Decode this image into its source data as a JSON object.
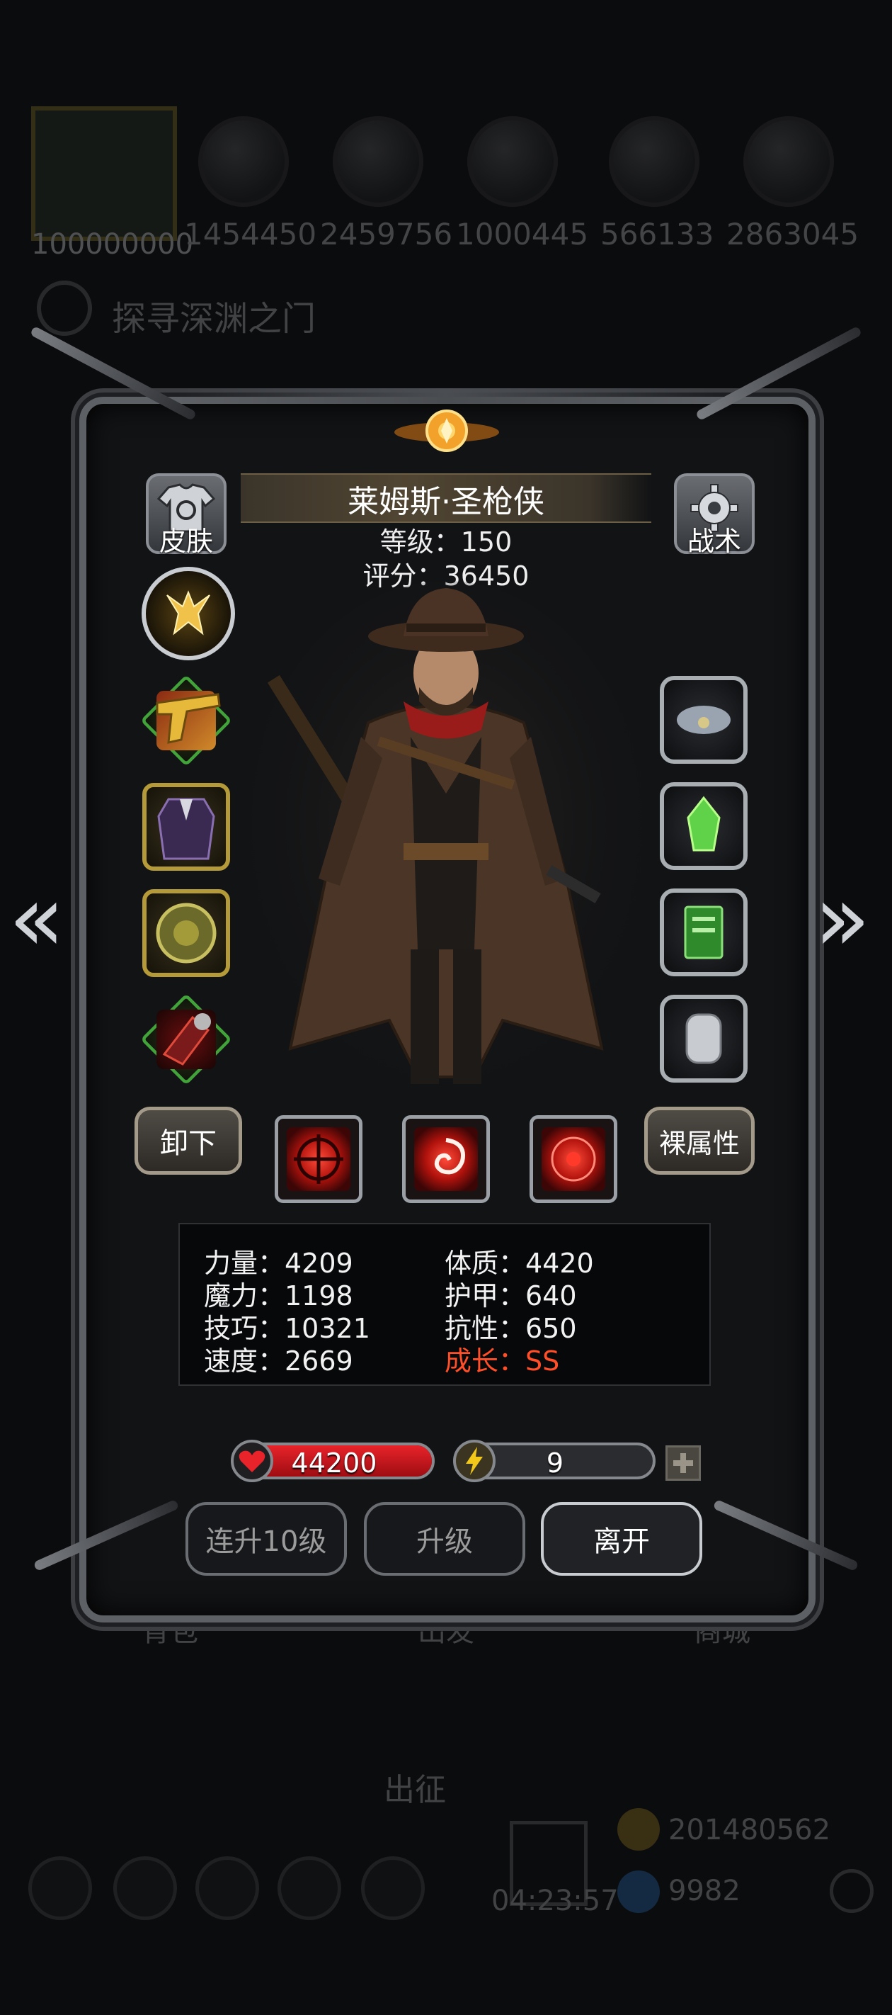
{
  "background": {
    "avatar_badge": "100000000",
    "resources": [
      "1454450",
      "2459756",
      "1000445",
      "566133",
      "2863045"
    ],
    "quest_title": "探寻深渊之门",
    "dimmed_tabs": [
      "背包",
      "出发",
      "商城"
    ],
    "depart_label": "出征",
    "gold_amount": "201480562",
    "gem_amount": "9982",
    "timer": "04:23:57"
  },
  "hero": {
    "name": "莱姆斯·圣枪侠",
    "level_line": "等级：150",
    "score_line": "评分：36450"
  },
  "top_buttons": {
    "skin_label": "皮肤",
    "tactics_label": "战术"
  },
  "actions": {
    "unequip_label": "卸下",
    "base_attr_label": "裸属性"
  },
  "stats": {
    "strength": "力量：4209",
    "constitution": "体质：4420",
    "magic": "魔力：1198",
    "armor": "护甲：640",
    "skill": "技巧：10321",
    "resistance": "抗性：650",
    "speed": "速度：2669",
    "growth": "成长：SS"
  },
  "bars": {
    "hp_value": "44200",
    "hp_fill": 1.0,
    "energy_value": "9",
    "energy_fill": 0.08
  },
  "bottom_buttons": {
    "level10_label": "连升10级",
    "level_label": "升级",
    "leave_label": "离开"
  },
  "colors": {
    "hp_red": "#c8141a",
    "energy_yellow": "#e6c21a",
    "growth_red": "#ff4e28",
    "slot_gold": "#b59a3a",
    "slot_green": "#42a33a"
  }
}
